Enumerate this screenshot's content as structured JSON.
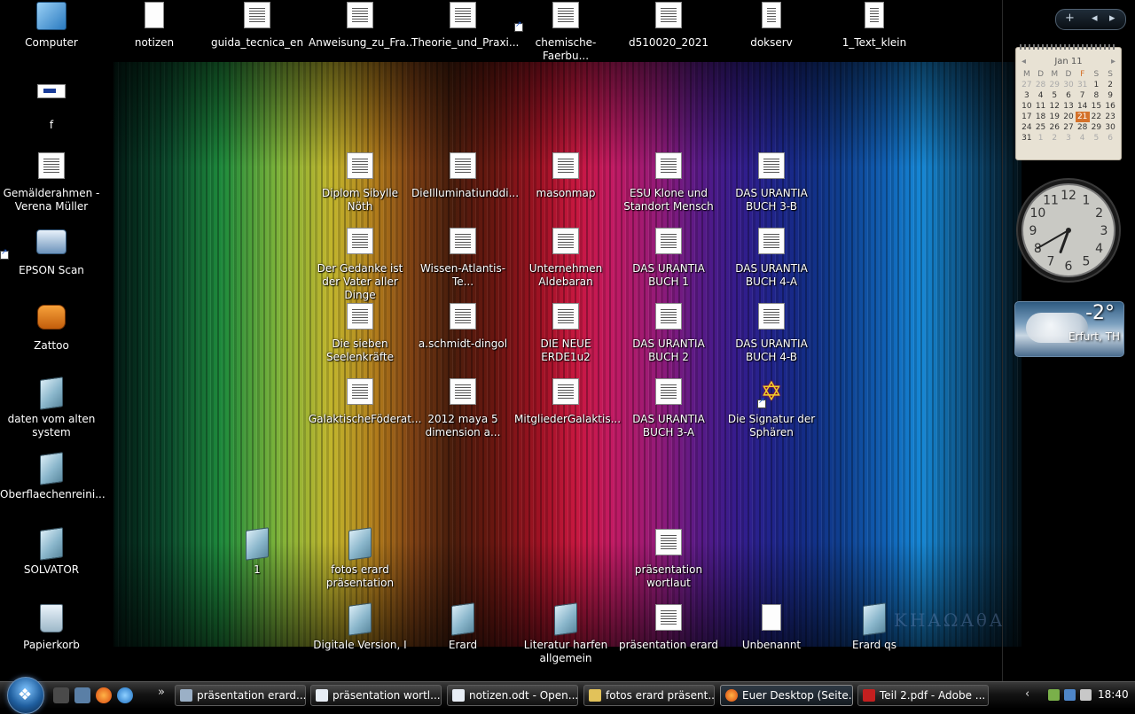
{
  "desktop_icons": {
    "computer": "Computer",
    "f": "f",
    "gemaelde": "Gemälderahmen - Verena Müller",
    "epson": "EPSON Scan",
    "zattoo": "Zattoo",
    "daten": "daten vom alten system",
    "oberflaechen": "Oberflaechenreini...",
    "solvator": "SOLVATOR",
    "papierkorb": "Papierkorb",
    "notizen": "notizen",
    "guida": "guida_tecnica_en",
    "anweisung": "Anweisung_zu_Fra...",
    "theorie": "Theorie_und_Praxi...",
    "chemische": "chemische-Faerbu...",
    "d510020": "d510020_2021",
    "dokserv": "dokserv",
    "text_klein": "1_Text_klein",
    "diplom": "Diplom Sibylle Nöth",
    "illuminati": "DieIlluminatiunddi...",
    "masonmap": "masonmap",
    "esu": "ESU Klone und Standort Mensch",
    "urantia_3b": "DAS URANTIA BUCH 3-B",
    "gedanke": "Der Gedanke ist der Vater aller Dinge",
    "atlantis": "Wissen-Atlantis-Te...",
    "aldebaran": "Unternehmen Aldebaran",
    "urantia_1": "DAS URANTIA BUCH 1",
    "urantia_4a": "DAS URANTIA BUCH 4-A",
    "sieben": "Die sieben Seelenkräfte",
    "schmidt": "a.schmidt-dingol",
    "neue_erde": "DIE NEUE ERDE1u2",
    "urantia_2": "DAS URANTIA BUCH 2",
    "urantia_4b": "DAS URANTIA BUCH 4-B",
    "galaktische": "GalaktischeFöderat...",
    "maya": "2012 maya 5 dimension a...",
    "mitglieder": "MitgliederGalaktis...",
    "urantia_3a": "DAS URANTIA BUCH 3-A",
    "signatur": "Die Signatur der Sphären",
    "eins": "1",
    "fotos": "fotos erard präsentation",
    "praes_wortlaut": "präsentation wortlaut",
    "digitale": "Digitale Version, I",
    "erard": "Erard",
    "literatur": "Literatur harfen allgemein",
    "praes_erard": "präsentation erard",
    "unbenannt": "Unbenannt",
    "erard_qs": "Erard  qs"
  },
  "wallpaper_text": "KHAΩAθA",
  "calendar": {
    "month": "Jan 11",
    "weekdays": [
      "M",
      "D",
      "M",
      "D",
      "F",
      "S",
      "S"
    ],
    "weeks": [
      [
        {
          "d": "27",
          "dim": true
        },
        {
          "d": "28",
          "dim": true
        },
        {
          "d": "29",
          "dim": true
        },
        {
          "d": "30",
          "dim": true
        },
        {
          "d": "31",
          "dim": true
        },
        {
          "d": "1"
        },
        {
          "d": "2"
        }
      ],
      [
        {
          "d": "3"
        },
        {
          "d": "4"
        },
        {
          "d": "5"
        },
        {
          "d": "6"
        },
        {
          "d": "7"
        },
        {
          "d": "8"
        },
        {
          "d": "9"
        }
      ],
      [
        {
          "d": "10"
        },
        {
          "d": "11"
        },
        {
          "d": "12"
        },
        {
          "d": "13"
        },
        {
          "d": "14"
        },
        {
          "d": "15"
        },
        {
          "d": "16"
        }
      ],
      [
        {
          "d": "17"
        },
        {
          "d": "18"
        },
        {
          "d": "19"
        },
        {
          "d": "20"
        },
        {
          "d": "21",
          "today": true
        },
        {
          "d": "22"
        },
        {
          "d": "23"
        }
      ],
      [
        {
          "d": "24"
        },
        {
          "d": "25"
        },
        {
          "d": "26"
        },
        {
          "d": "27"
        },
        {
          "d": "28"
        },
        {
          "d": "29"
        },
        {
          "d": "30"
        }
      ],
      [
        {
          "d": "31"
        },
        {
          "d": "1",
          "dim": true
        },
        {
          "d": "2",
          "dim": true
        },
        {
          "d": "3",
          "dim": true
        },
        {
          "d": "4",
          "dim": true
        },
        {
          "d": "5",
          "dim": true
        },
        {
          "d": "6",
          "dim": true
        }
      ]
    ]
  },
  "clock_gadget": {
    "hour": 6,
    "minute": 40
  },
  "weather": {
    "temp": "-2°",
    "city": "Erfurt, TH"
  },
  "gadget_controls": {
    "add": "+",
    "prev": "◂",
    "next": "▸"
  },
  "taskbar": {
    "overflow": "»",
    "buttons": [
      "präsentation erard....",
      "präsentation wortl...",
      "notizen.odt - Open...",
      "fotos erard präsent...",
      "Euer Desktop (Seite...",
      "Teil 2.pdf - Adobe ..."
    ],
    "tray_arrow": "‹",
    "time": "18:40"
  },
  "colors": {
    "calendar_today": "#d4712a",
    "taskbar_bg": "#141414"
  }
}
